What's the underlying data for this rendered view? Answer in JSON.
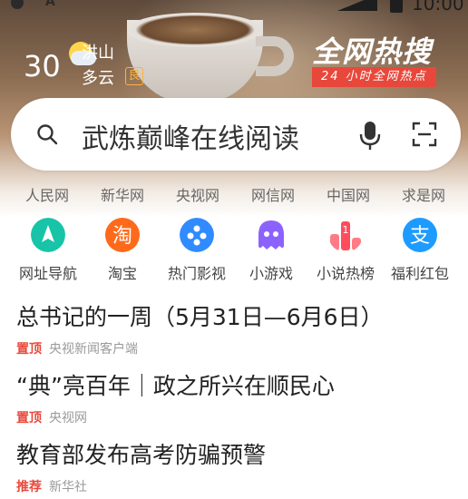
{
  "status_bar": {
    "time": "10:00"
  },
  "weather": {
    "temperature": "30",
    "city": "洪山",
    "condition": "多云",
    "aqi": "良"
  },
  "promo": {
    "title": "全网热搜",
    "subtitle": "24 小时全网热点"
  },
  "search": {
    "query": "武炼巅峰在线阅读"
  },
  "quick_links": [
    "人民网",
    "新华网",
    "央视网",
    "网信网",
    "中国网",
    "求是网"
  ],
  "apps": [
    {
      "label": "网址导航",
      "icon": "navigation-icon",
      "color": "#18c4a8"
    },
    {
      "label": "淘宝",
      "icon": "taobao-icon",
      "color": "#ff6a1a"
    },
    {
      "label": "热门影视",
      "icon": "video-icon",
      "color": "#2f8bff"
    },
    {
      "label": "小游戏",
      "icon": "game-ghost-icon",
      "color": "#8c62ff"
    },
    {
      "label": "小说热榜",
      "icon": "ranking-icon",
      "color": "#ff4c5c"
    },
    {
      "label": "福利红包",
      "icon": "alipay-icon",
      "color": "#1e9bff"
    }
  ],
  "news": [
    {
      "title": "总书记的一周（5月31日—6月6日）",
      "tag": "置顶",
      "source": "央视新闻客户端",
      "tag_color": "#e8483b"
    },
    {
      "title": "“典”亮百年｜政之所兴在顺民心",
      "tag": "置顶",
      "source": "央视网",
      "tag_color": "#e8483b"
    },
    {
      "title": "教育部发布高考防骗预警",
      "tag": "推荐",
      "source": "新华社",
      "tag_color": "#e8483b"
    }
  ]
}
